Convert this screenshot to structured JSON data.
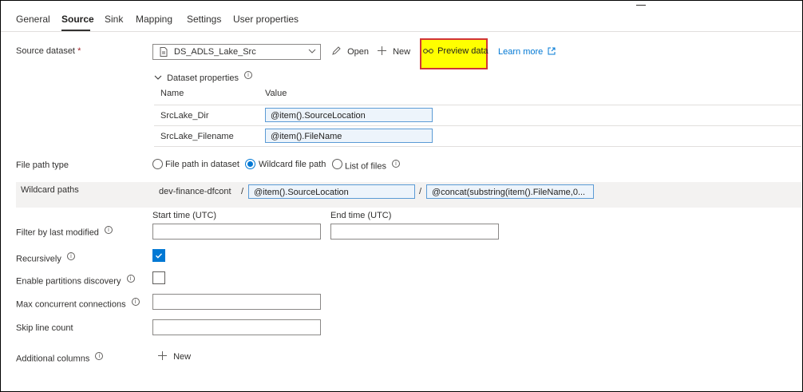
{
  "tabs": [
    {
      "label": "General"
    },
    {
      "label": "Source"
    },
    {
      "label": "Sink"
    },
    {
      "label": "Mapping"
    },
    {
      "label": "Settings"
    },
    {
      "label": "User properties"
    }
  ],
  "source_dataset": {
    "label": "Source dataset",
    "required_mark": "*",
    "selected": "DS_ADLS_Lake_Src",
    "open_label": "Open",
    "new_label": "New",
    "preview_label": "Preview data",
    "learn_more_label": "Learn more"
  },
  "dataset_properties": {
    "title": "Dataset properties",
    "col_name": "Name",
    "col_value": "Value",
    "rows": [
      {
        "name": "SrcLake_Dir",
        "value": "@item().SourceLocation"
      },
      {
        "name": "SrcLake_Filename",
        "value": "@item().FileName"
      }
    ]
  },
  "file_path_type": {
    "label": "File path type",
    "options": [
      "File path in dataset",
      "Wildcard file path",
      "List of files"
    ],
    "selected": "Wildcard file path"
  },
  "wildcard_paths": {
    "label": "Wildcard paths",
    "container": "dev-finance-dfcont",
    "sep": "/",
    "folder": "@item().SourceLocation",
    "file": "@concat(substring(item().FileName,0..."
  },
  "filter_last_modified": {
    "label": "Filter by last modified",
    "start_label": "Start time (UTC)",
    "end_label": "End time (UTC)",
    "start_value": "",
    "end_value": ""
  },
  "recursively": {
    "label": "Recursively",
    "checked": true
  },
  "partitions": {
    "label": "Enable partitions discovery",
    "checked": false
  },
  "max_connections": {
    "label": "Max concurrent connections",
    "value": ""
  },
  "skip_lines": {
    "label": "Skip line count",
    "value": ""
  },
  "additional_columns": {
    "label": "Additional columns",
    "new_label": "New"
  },
  "colors": {
    "accent": "#0078d4",
    "highlight": "#ffff00",
    "highlight_border": "#d13438"
  }
}
